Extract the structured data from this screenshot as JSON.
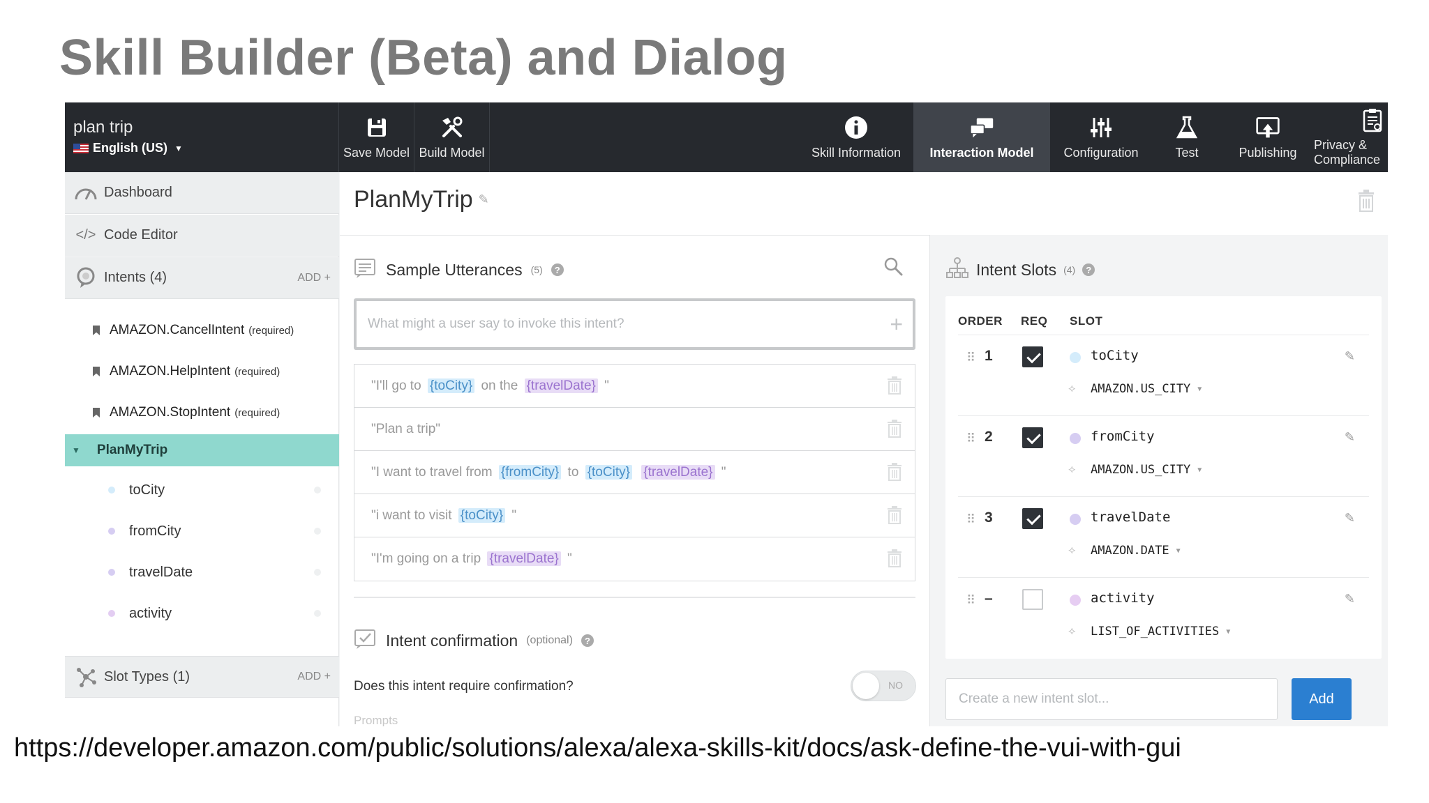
{
  "slide": {
    "title": "Skill Builder (Beta) and Dialog",
    "source_url": "https://developer.amazon.com/public/solutions/alexa/alexa-skills-kit/docs/ask-define-the-vui-with-gui"
  },
  "topbar": {
    "skill_name": "plan trip",
    "locale": "English (US)",
    "buttons": [
      {
        "label": "Save Model",
        "icon": "save-icon"
      },
      {
        "label": "Build Model",
        "icon": "tools-icon"
      },
      {
        "label": "Skill Information",
        "icon": "info-icon"
      },
      {
        "label": "Interaction Model",
        "icon": "chat-icon",
        "active": true
      },
      {
        "label": "Configuration",
        "icon": "sliders-icon"
      },
      {
        "label": "Test",
        "icon": "flask-icon"
      },
      {
        "label": "Publishing",
        "icon": "publish-icon"
      },
      {
        "label": "Privacy & Compliance",
        "icon": "clipboard-icon"
      }
    ]
  },
  "sidebar": {
    "dashboard": "Dashboard",
    "code_editor": "Code Editor",
    "intents_label": "Intents (4)",
    "add_label": "ADD +",
    "builtin_intents": [
      {
        "name": "AMAZON.CancelIntent",
        "tag": "(required)"
      },
      {
        "name": "AMAZON.HelpIntent",
        "tag": "(required)"
      },
      {
        "name": "AMAZON.StopIntent",
        "tag": "(required)"
      }
    ],
    "active_intent": "PlanMyTrip",
    "slots": [
      {
        "name": "toCity",
        "color": "#d4ecfb"
      },
      {
        "name": "fromCity",
        "color": "#d6cdf2"
      },
      {
        "name": "travelDate",
        "color": "#d6cdf2"
      },
      {
        "name": "activity",
        "color": "#e3cdf2"
      }
    ],
    "slot_types_label": "Slot Types (1)"
  },
  "main": {
    "intent_title": "PlanMyTrip",
    "utterances": {
      "heading": "Sample Utterances",
      "count": "(5)",
      "placeholder": "What might a user say to invoke this intent?",
      "rows": [
        {
          "parts": [
            {
              "t": "\"I'll go to "
            },
            {
              "s": "{toCity}",
              "c": "blue"
            },
            {
              "t": " on the "
            },
            {
              "s": "{travelDate}",
              "c": "purple"
            },
            {
              "t": " \""
            }
          ]
        },
        {
          "parts": [
            {
              "t": "\"Plan a trip\""
            }
          ]
        },
        {
          "parts": [
            {
              "t": "\"I want to travel from "
            },
            {
              "s": "{fromCity}",
              "c": "blue"
            },
            {
              "t": " to "
            },
            {
              "s": "{toCity}",
              "c": "blue"
            },
            {
              "t": " "
            },
            {
              "s": "{travelDate}",
              "c": "purple"
            },
            {
              "t": " \""
            }
          ]
        },
        {
          "parts": [
            {
              "t": "\"i want to visit "
            },
            {
              "s": "{toCity}",
              "c": "blue"
            },
            {
              "t": " \""
            }
          ]
        },
        {
          "parts": [
            {
              "t": "\"I'm going on a trip "
            },
            {
              "s": "{travelDate}",
              "c": "purple"
            },
            {
              "t": " \""
            }
          ]
        }
      ]
    },
    "confirmation": {
      "heading": "Intent confirmation",
      "optional": "(optional)",
      "question": "Does this intent require confirmation?",
      "toggle_label": "NO",
      "prompts_label": "Prompts"
    },
    "intent_slots": {
      "heading": "Intent Slots",
      "count": "(4)",
      "col_order": "ORDER",
      "col_req": "REQ",
      "col_slot": "SLOT",
      "rows": [
        {
          "order": "1",
          "required": true,
          "name": "toCity",
          "type": "AMAZON.US_CITY",
          "color": "#d4ecfb"
        },
        {
          "order": "2",
          "required": true,
          "name": "fromCity",
          "type": "AMAZON.US_CITY",
          "color": "#d6cdf2"
        },
        {
          "order": "3",
          "required": true,
          "name": "travelDate",
          "type": "AMAZON.DATE",
          "color": "#d6cdf2"
        },
        {
          "order": "–",
          "required": false,
          "name": "activity",
          "type": "LIST_OF_ACTIVITIES",
          "color": "#e6cdf2"
        }
      ],
      "new_slot_placeholder": "Create a new intent slot...",
      "add_button": "Add"
    }
  }
}
